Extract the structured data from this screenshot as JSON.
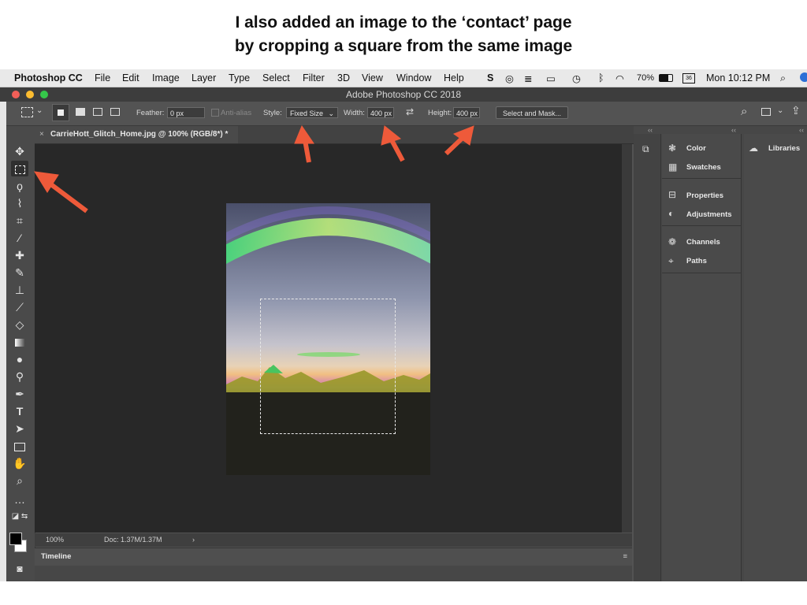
{
  "caption": {
    "line1": "I also added an image to the ‘contact’ page",
    "line2": "by cropping a square from the same image"
  },
  "menubar": {
    "apple": "",
    "app_name": "Photoshop CC",
    "menus": [
      "File",
      "Edit",
      "Image",
      "Layer",
      "Type",
      "Select",
      "Filter",
      "3D",
      "View",
      "Window",
      "Help"
    ],
    "battery": "70%",
    "clock": "Mon 10:12 PM"
  },
  "window": {
    "title": "Adobe Photoshop CC 2018"
  },
  "options_bar": {
    "feather_label": "Feather:",
    "feather_value": "0 px",
    "antialias_label": "Anti-alias",
    "style_label": "Style:",
    "style_value": "Fixed Size",
    "width_label": "Width:",
    "width_value": "400 px",
    "height_label": "Height:",
    "height_value": "400 px",
    "select_mask_button": "Select and Mask..."
  },
  "document": {
    "tab_label": "CarrieHott_Glitch_Home.jpg @ 100% (RGB/8*) *",
    "close_glyph": "×"
  },
  "status": {
    "zoom": "100%",
    "doc_size": "Doc: 1.37M/1.37M",
    "chevron": "›"
  },
  "timeline": {
    "title": "Timeline"
  },
  "panels": {
    "group1": [
      "Color",
      "Swatches"
    ],
    "group2": [
      "Properties",
      "Adjustments"
    ],
    "group3": [
      "Channels",
      "Paths"
    ],
    "libraries": "Libraries"
  },
  "tools": [
    "move-tool",
    "marquee-tool",
    "lasso-tool",
    "quick-select-tool",
    "crop-tool",
    "eyedropper-tool",
    "healing-tool",
    "brush-tool",
    "stamp-tool",
    "history-brush-tool",
    "eraser-tool",
    "gradient-tool",
    "blur-tool",
    "dodge-tool",
    "pen-tool",
    "type-tool",
    "path-select-tool",
    "rectangle-tool",
    "hand-tool",
    "zoom-tool",
    "more-tools"
  ],
  "colors": {
    "arrow": "#ee5a3a",
    "ui_dark": "#535353",
    "canvas_bg": "#282828"
  }
}
